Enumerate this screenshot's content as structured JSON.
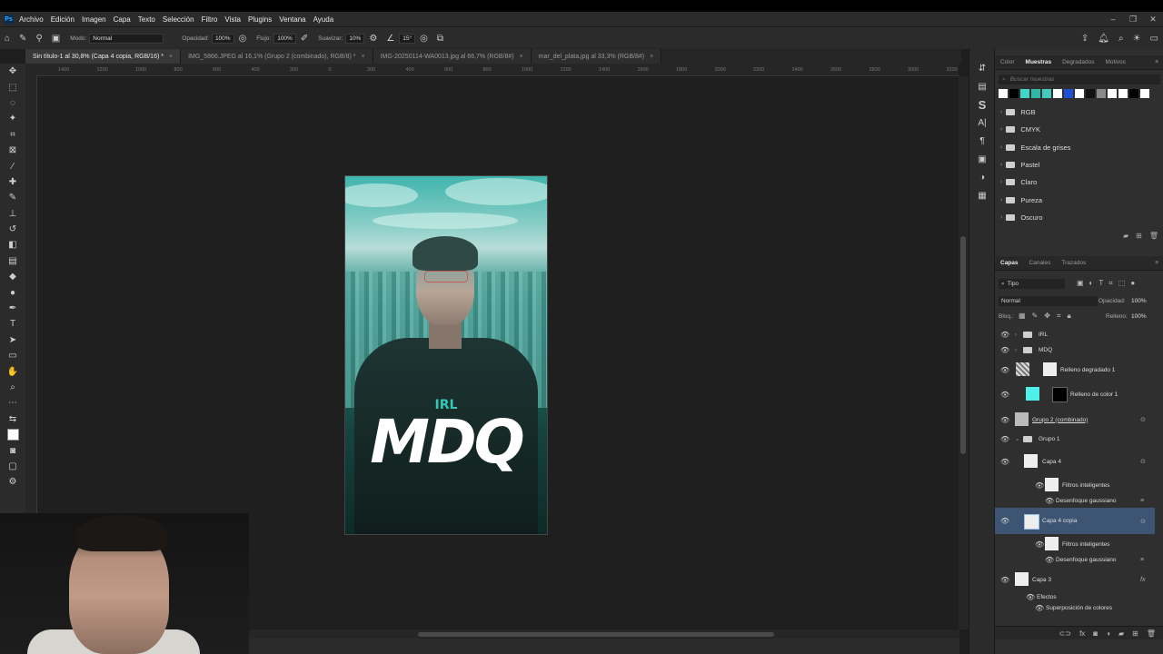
{
  "app": {
    "logo": "Ps"
  },
  "menu": [
    "Archivo",
    "Edición",
    "Imagen",
    "Capa",
    "Texto",
    "Selección",
    "Filtro",
    "Vista",
    "Plugins",
    "Ventana",
    "Ayuda"
  ],
  "options": {
    "mode_label": "Modo:",
    "mode_value": "Normal",
    "opacity_label": "Opacidad:",
    "opacity_value": "100%",
    "flow_label": "Flujo:",
    "flow_value": "100%",
    "smooth_label": "Suavizar:",
    "smooth_value": "10%",
    "angle_value": "15°"
  },
  "tabs": [
    {
      "label": "Sin título-1 al 30,8% (Capa 4 copia, RGB/16) *",
      "active": true
    },
    {
      "label": "IMG_5866.JPEG al 16,1% (Grupo 2 (combinado), RGB/8) *",
      "active": false
    },
    {
      "label": "IMG-20250114-WA0013.jpg al 66,7% (RGB/8#)",
      "active": false
    },
    {
      "label": "mar_del_plata.jpg al 33,3% (RGB/8#)",
      "active": false
    }
  ],
  "ruler_ticks": [
    "1400",
    "1200",
    "1000",
    "800",
    "600",
    "400",
    "200",
    "0",
    "200",
    "400",
    "600",
    "800",
    "1000",
    "1200",
    "1400",
    "1600",
    "1800",
    "2000",
    "2200",
    "2400",
    "2600",
    "2800",
    "3000",
    "3200"
  ],
  "artwork": {
    "small_text": "IRL",
    "big_text": "MDQ"
  },
  "swatches_panel": {
    "tabs": [
      "Color",
      "Muestras",
      "Degradados",
      "Motivos"
    ],
    "active_tab": "Muestras",
    "search_placeholder": "Buscar muestras",
    "swatch_colors": [
      "#ffffff",
      "#000000",
      "#3fd6c8",
      "#2fb8aa",
      "#44c9bd",
      "#ffffff",
      "#1f4fd6",
      "#ffffff",
      "#111111",
      "#8a8a8a",
      "#ffffff",
      "#ffffff",
      "#000000",
      "#ffffff"
    ],
    "folders": [
      "RGB",
      "CMYK",
      "Escala de grises",
      "Pastel",
      "Claro",
      "Pureza",
      "Oscuro"
    ]
  },
  "layers_panel": {
    "tabs": [
      "Capas",
      "Canales",
      "Trazados"
    ],
    "active_tab": "Capas",
    "filter_value": "Tipo",
    "blend_value": "Normal",
    "opacity_label": "Opacidad:",
    "opacity_value": "100%",
    "lock_label": "Bloq.:",
    "fill_label": "Relleno:",
    "fill_value": "100%",
    "layers": [
      {
        "name": "IRL",
        "kind": "group",
        "selected": false
      },
      {
        "name": "MDQ",
        "kind": "group",
        "selected": false
      },
      {
        "name": "Relleno degradado 1",
        "kind": "gradient",
        "selected": false
      },
      {
        "name": "Relleno de color 1",
        "kind": "color",
        "selected": false
      },
      {
        "name": "Grupo 2 (combinado)",
        "kind": "image",
        "selected": false
      },
      {
        "name": "Grupo 1",
        "kind": "group-open",
        "selected": false
      },
      {
        "name": "Capa 4",
        "kind": "smart",
        "selected": false
      },
      {
        "name": "Filtros inteligentes",
        "kind": "filter",
        "selected": false
      },
      {
        "name": "Desenfoque gaussiano",
        "kind": "filter-item",
        "selected": false
      },
      {
        "name": "Capa 4 copia",
        "kind": "smart",
        "selected": true
      },
      {
        "name": "Filtros inteligentes",
        "kind": "filter",
        "selected": false
      },
      {
        "name": "Desenfoque gaussiano",
        "kind": "filter-item",
        "selected": false
      },
      {
        "name": "Capa 3",
        "kind": "image",
        "selected": false
      },
      {
        "name": "Efectos",
        "kind": "effects",
        "selected": false
      },
      {
        "name": "Superposición de colores",
        "kind": "effect-item",
        "selected": false
      }
    ]
  }
}
